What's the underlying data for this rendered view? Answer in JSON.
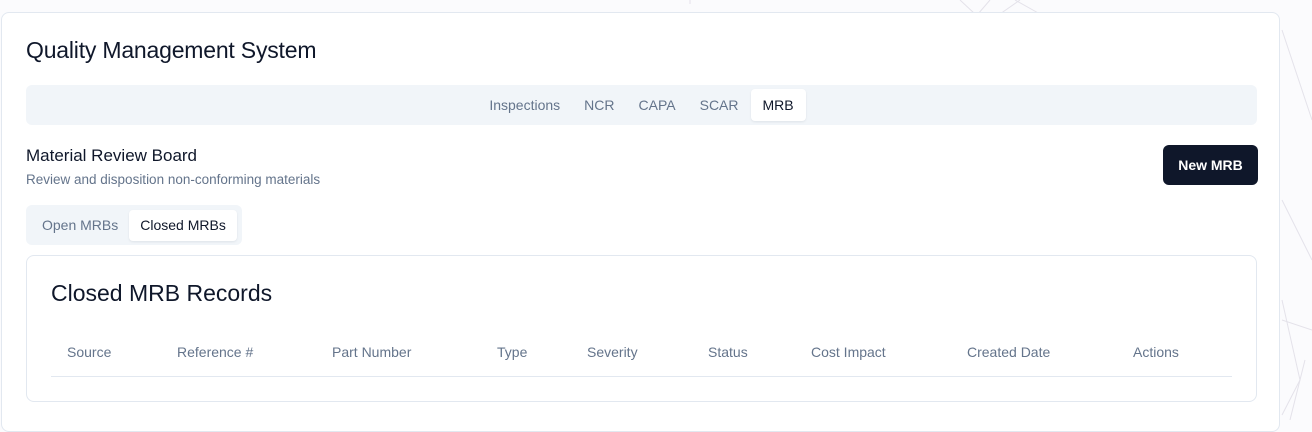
{
  "app": {
    "title": "Quality Management System"
  },
  "main_tabs": [
    {
      "label": "Inspections",
      "active": false
    },
    {
      "label": "NCR",
      "active": false
    },
    {
      "label": "CAPA",
      "active": false
    },
    {
      "label": "SCAR",
      "active": false
    },
    {
      "label": "MRB",
      "active": true
    }
  ],
  "section": {
    "title": "Material Review Board",
    "subtitle": "Review and disposition non-conforming materials",
    "new_button_label": "New MRB"
  },
  "sub_tabs": [
    {
      "label": "Open MRBs",
      "active": false
    },
    {
      "label": "Closed MRBs",
      "active": true
    }
  ],
  "records": {
    "title": "Closed MRB Records",
    "columns": [
      "Source",
      "Reference #",
      "Part Number",
      "Type",
      "Severity",
      "Status",
      "Cost Impact",
      "Created Date",
      "Actions"
    ]
  },
  "colors": {
    "primary": "#0f172a",
    "muted_text": "#64748b",
    "tab_background": "#f1f5f9",
    "border": "#e2e8f0"
  }
}
